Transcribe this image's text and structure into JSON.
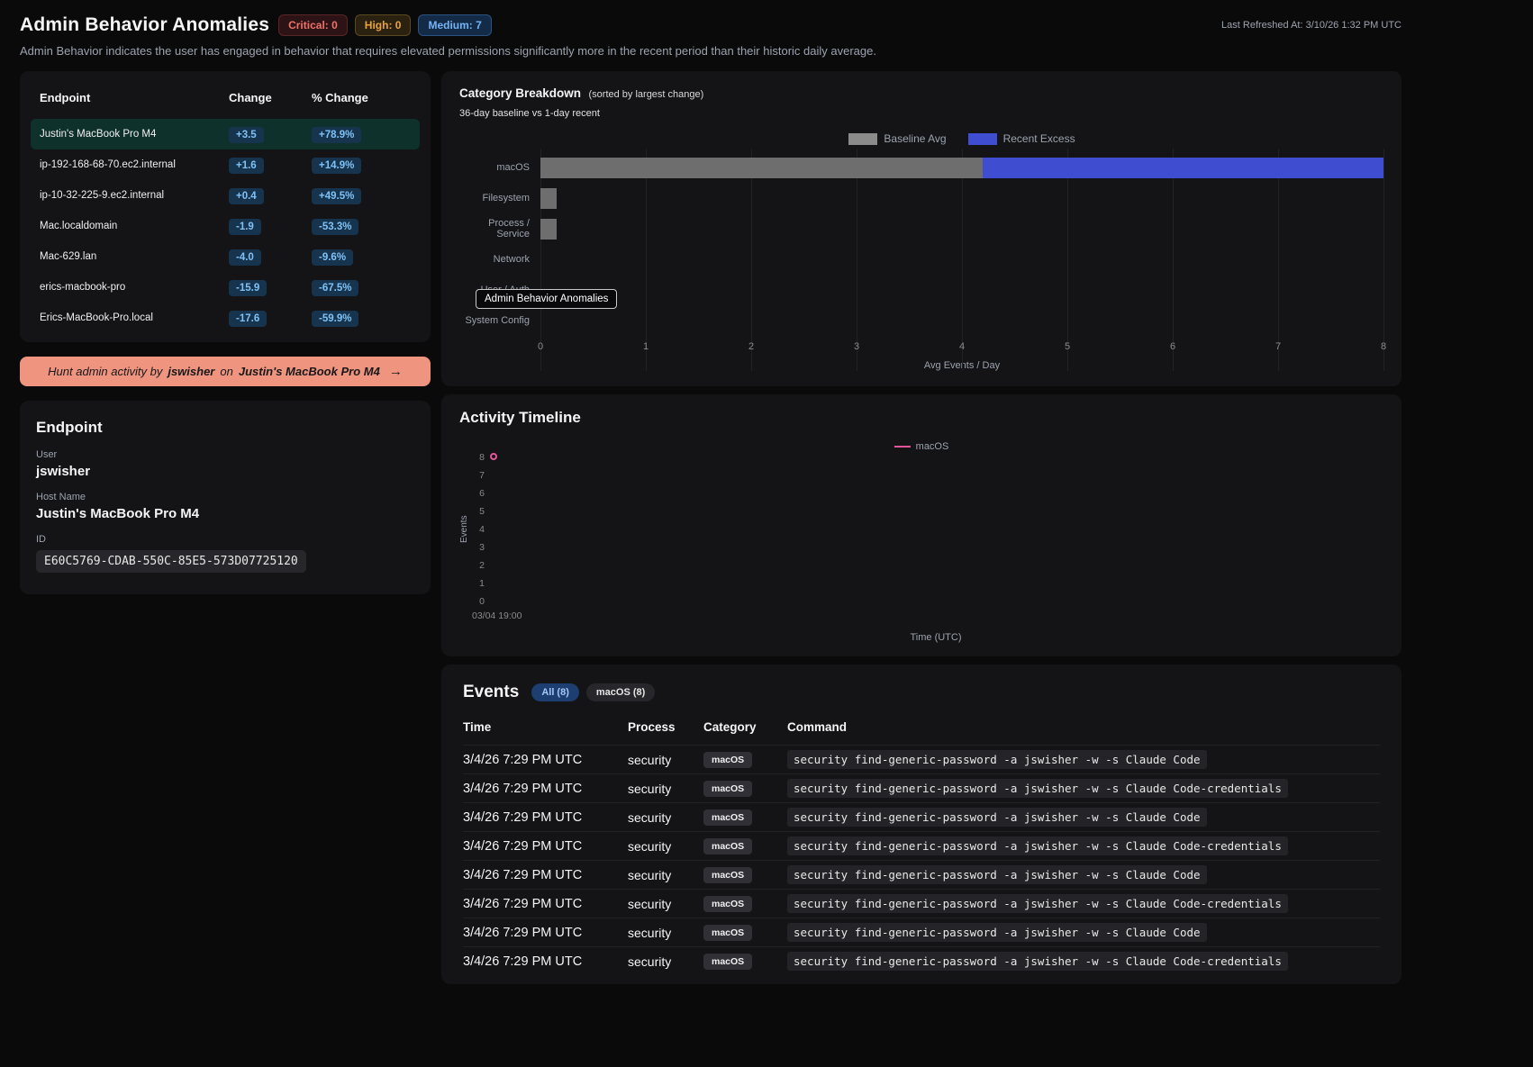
{
  "header": {
    "title": "Admin Behavior Anomalies",
    "badges": [
      {
        "label": "Critical: 0",
        "type": "critical"
      },
      {
        "label": "High: 0",
        "type": "high"
      },
      {
        "label": "Medium: 7",
        "type": "medium"
      }
    ],
    "last_refreshed": "Last Refreshed At: 3/10/26 1:32 PM UTC",
    "description": "Admin Behavior indicates the user has engaged in behavior that requires elevated permissions significantly more in the recent period than their historic daily average."
  },
  "endpoint_table": {
    "columns": [
      "Endpoint",
      "Change",
      "% Change"
    ],
    "rows": [
      {
        "endpoint": "Justin's MacBook Pro M4",
        "change": "+3.5",
        "pct_change": "+78.9%",
        "selected": true
      },
      {
        "endpoint": "ip-192-168-68-70.ec2.internal",
        "change": "+1.6",
        "pct_change": "+14.9%",
        "selected": false
      },
      {
        "endpoint": "ip-10-32-225-9.ec2.internal",
        "change": "+0.4",
        "pct_change": "+49.5%",
        "selected": false
      },
      {
        "endpoint": "Mac.localdomain",
        "change": "-1.9",
        "pct_change": "-53.3%",
        "selected": false
      },
      {
        "endpoint": "Mac-629.lan",
        "change": "-4.0",
        "pct_change": "-9.6%",
        "selected": false
      },
      {
        "endpoint": "erics-macbook-pro",
        "change": "-15.9",
        "pct_change": "-67.5%",
        "selected": false
      },
      {
        "endpoint": "Erics-MacBook-Pro.local",
        "change": "-17.6",
        "pct_change": "-59.9%",
        "selected": false
      }
    ]
  },
  "hunt_button": {
    "prefix": "Hunt admin activity by",
    "user": "jswisher",
    "middle": "on",
    "host": "Justin's MacBook Pro M4",
    "arrow": "→"
  },
  "endpoint_details": {
    "title": "Endpoint",
    "user_label": "User",
    "user": "jswisher",
    "host_label": "Host Name",
    "host": "Justin's MacBook Pro M4",
    "id_label": "ID",
    "id": "E60C5769-CDAB-550C-85E5-573D07725120"
  },
  "chart_data": [
    {
      "type": "bar",
      "orientation": "horizontal",
      "title": "Category Breakdown",
      "title_note": "(sorted by largest change)",
      "subtitle": "36-day baseline vs 1-day recent",
      "categories": [
        "macOS",
        "Filesystem",
        "Process / Service",
        "Network",
        "User / Auth",
        "System Config"
      ],
      "series": [
        {
          "name": "Baseline Avg",
          "color": "#8b8b8b",
          "bar_color": "#6e6e6e",
          "values": [
            4.2,
            0.15,
            0.15,
            0,
            0,
            0
          ]
        },
        {
          "name": "Recent Excess",
          "color": "#3f4ed1",
          "bar_color": "#3f4ed1",
          "values": [
            3.8,
            0,
            0,
            0,
            0,
            0
          ]
        }
      ],
      "xlabel": "Avg Events / Day",
      "xlim": [
        0,
        8
      ],
      "xticks": [
        0,
        1,
        2,
        3,
        4,
        5,
        6,
        7,
        8
      ],
      "grid": true,
      "legend_position": "top",
      "tooltip": "Admin Behavior Anomalies"
    },
    {
      "type": "line",
      "title": "Activity Timeline",
      "series": [
        {
          "name": "macOS",
          "color": "#e8549c",
          "points": [
            {
              "x": "03/04 19:00",
              "y": 8
            }
          ]
        }
      ],
      "ylabel": "Events",
      "xlabel": "Time (UTC)",
      "ylim": [
        0,
        8
      ],
      "yticks": [
        8,
        7,
        6,
        5,
        4,
        3,
        2,
        1,
        0
      ],
      "xticks": [
        "03/04 19:00"
      ],
      "legend_position": "top"
    }
  ],
  "events": {
    "title": "Events",
    "tabs": [
      {
        "label": "All (8)",
        "active": true
      },
      {
        "label": "macOS (8)",
        "active": false
      }
    ],
    "columns": [
      "Time",
      "Process",
      "Category",
      "Command"
    ],
    "rows": [
      {
        "time": "3/4/26 7:29 PM UTC",
        "process": "security",
        "category": "macOS",
        "command": "security find-generic-password -a jswisher -w -s Claude Code"
      },
      {
        "time": "3/4/26 7:29 PM UTC",
        "process": "security",
        "category": "macOS",
        "command": "security find-generic-password -a jswisher -w -s Claude Code-credentials"
      },
      {
        "time": "3/4/26 7:29 PM UTC",
        "process": "security",
        "category": "macOS",
        "command": "security find-generic-password -a jswisher -w -s Claude Code"
      },
      {
        "time": "3/4/26 7:29 PM UTC",
        "process": "security",
        "category": "macOS",
        "command": "security find-generic-password -a jswisher -w -s Claude Code-credentials"
      },
      {
        "time": "3/4/26 7:29 PM UTC",
        "process": "security",
        "category": "macOS",
        "command": "security find-generic-password -a jswisher -w -s Claude Code"
      },
      {
        "time": "3/4/26 7:29 PM UTC",
        "process": "security",
        "category": "macOS",
        "command": "security find-generic-password -a jswisher -w -s Claude Code-credentials"
      },
      {
        "time": "3/4/26 7:29 PM UTC",
        "process": "security",
        "category": "macOS",
        "command": "security find-generic-password -a jswisher -w -s Claude Code"
      },
      {
        "time": "3/4/26 7:29 PM UTC",
        "process": "security",
        "category": "macOS",
        "command": "security find-generic-password -a jswisher -w -s Claude Code-credentials"
      }
    ]
  }
}
